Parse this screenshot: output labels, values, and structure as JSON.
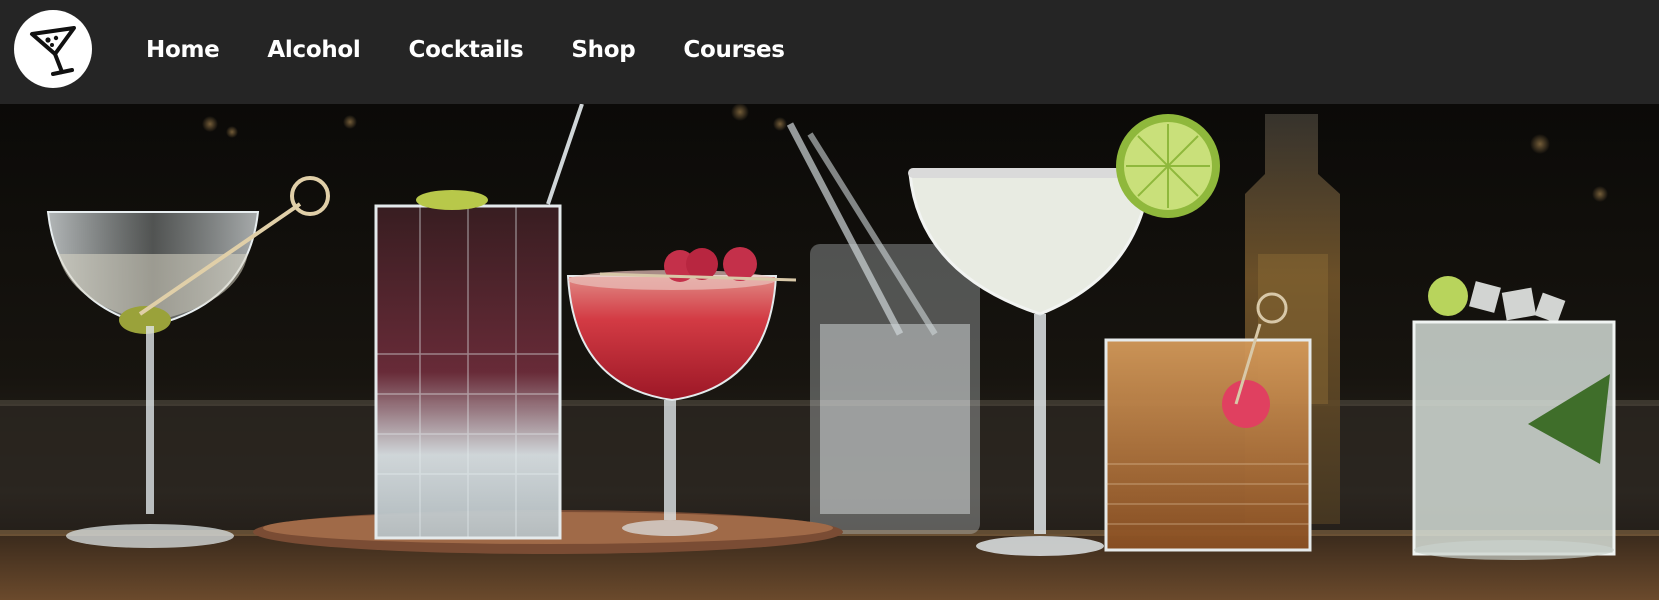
{
  "logo": {
    "icon": "martini-glass-icon"
  },
  "nav": {
    "items": [
      {
        "label": "Home"
      },
      {
        "label": "Alcohol"
      },
      {
        "label": "Cocktails"
      },
      {
        "label": "Shop"
      },
      {
        "label": "Courses"
      }
    ]
  },
  "hero": {
    "image": "cocktails-on-bar-counter"
  }
}
